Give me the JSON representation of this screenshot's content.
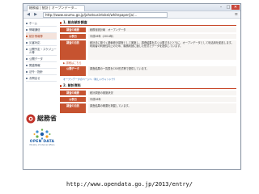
{
  "browser": {
    "tab_title": "総務省 | 統計 | オープンデータ…",
    "url": "http://www.soumu.go.jp/johotsusintokei/whitepaper/ja/…",
    "controls": {
      "min": "–",
      "max": "□",
      "close": "✕"
    },
    "back": "◀",
    "forward": "▶",
    "menu": "≡"
  },
  "sidebar": {
    "items": [
      {
        "label": "ホーム"
      },
      {
        "label": "情報通信"
      },
      {
        "label": "統計情報等",
        "active": true
      },
      {
        "label": "災害対応"
      },
      {
        "label": "公開予定・スケジュール等"
      },
      {
        "label": "公開データ"
      },
      {
        "label": "関連情報"
      },
      {
        "label": "法令・指針"
      },
      {
        "label": "お問合せ"
      }
    ]
  },
  "logos": {
    "ministry": "総務省",
    "opendata_title": "OPEN DATA",
    "opendata_sub": "Ministry of Internal Affairs"
  },
  "content": {
    "section1": {
      "heading": "1. 総合統計調査",
      "rows": [
        {
          "label": "調査の概要",
          "text": "総務省統計局　オープンデータ"
        },
        {
          "label": "公表日",
          "text": "平成26年（2014年）"
        },
        {
          "label": "調査の目的",
          "text": "統計法に基づく基幹統計調査として実施し、調査結果を広く公開するとともに、オープンデータとして利活用を促進します。利用者の利便性向上のため、機械判読に適した形式でデータを提供しています。"
        },
        {
          "label": "公開データ",
          "text": "調査結果の一覧表をCSV形式等で提供しています。"
        }
      ],
      "more_link": "▶ 詳細はこちら",
      "open_data_link": "オープンデータのページへ（新しいウィンドウ）"
    },
    "section2": {
      "heading": "2. 統計資料",
      "rows": [
        {
          "label": "調査の概要",
          "text": "統計調査の実施状況"
        },
        {
          "label": "公表日",
          "text": "平成26年"
        },
        {
          "label": "調査の目的",
          "text": "調査結果の概要を掲載しています。"
        }
      ]
    }
  },
  "caption": "http://www.opendata.go.jp/2013/entry/"
}
